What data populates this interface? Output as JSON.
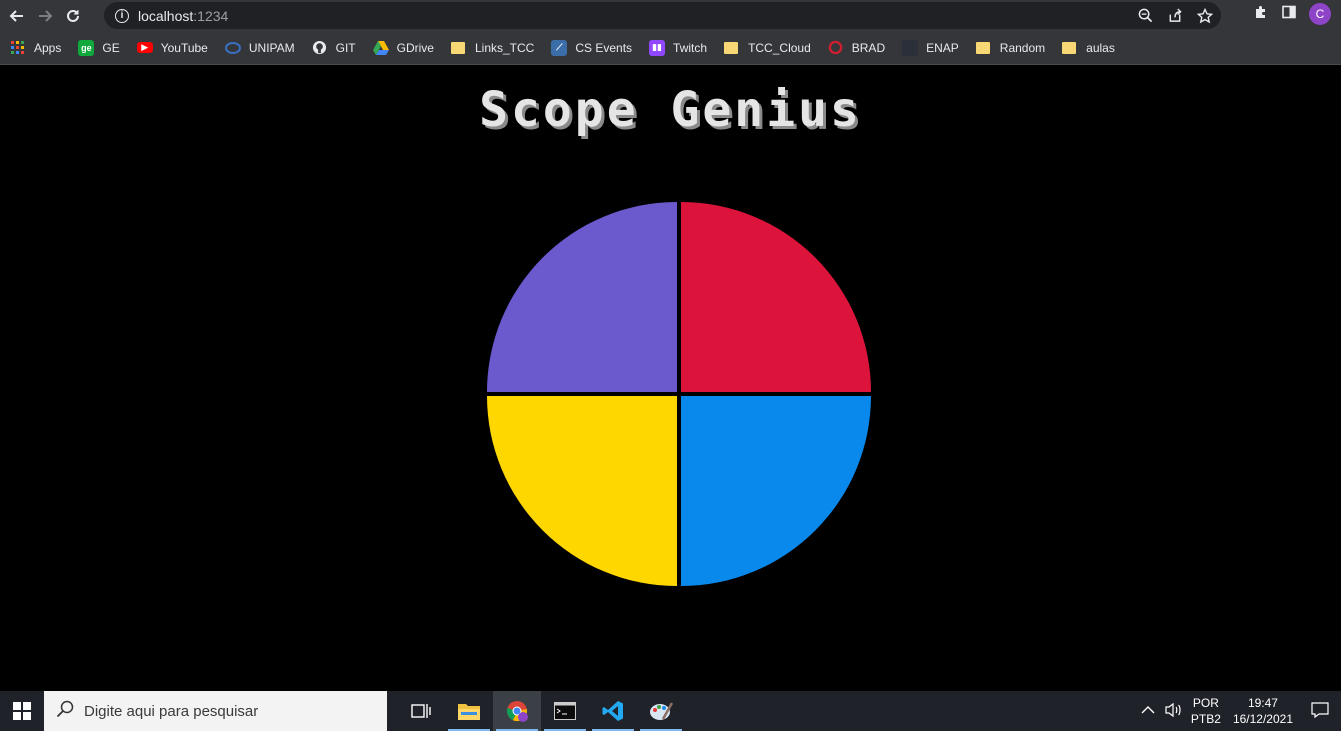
{
  "browser": {
    "url_host": "localhost",
    "url_port": ":1234",
    "avatar_letter": "C"
  },
  "bookmarks": [
    {
      "label": "Apps",
      "icon": "apps-grid-icon",
      "color": "#e8eaed"
    },
    {
      "label": "GE",
      "icon": "ge-icon",
      "color": "#0fa83c"
    },
    {
      "label": "YouTube",
      "icon": "youtube-icon",
      "color": "#ff0000"
    },
    {
      "label": "UNIPAM",
      "icon": "unipam-icon",
      "color": "#1f5fb0"
    },
    {
      "label": "GIT",
      "icon": "github-icon",
      "color": "#222222"
    },
    {
      "label": "GDrive",
      "icon": "gdrive-icon",
      "color": "#1fa463"
    },
    {
      "label": "Links_TCC",
      "icon": "folder-icon",
      "color": "#f8d775"
    },
    {
      "label": "CS Events",
      "icon": "cs-events-icon",
      "color": "#3b6ea8"
    },
    {
      "label": "Twitch",
      "icon": "twitch-icon",
      "color": "#9146ff"
    },
    {
      "label": "TCC_Cloud",
      "icon": "folder-icon",
      "color": "#f8d775"
    },
    {
      "label": "BRAD",
      "icon": "brad-icon",
      "color": "#cc1f2f"
    },
    {
      "label": "ENAP",
      "icon": "enap-icon",
      "color": "#2a2f3a"
    },
    {
      "label": "Random",
      "icon": "folder-icon",
      "color": "#f8d775"
    },
    {
      "label": "aulas",
      "icon": "folder-icon",
      "color": "#f8d775"
    }
  ],
  "page": {
    "title": "Scope Genius",
    "quadrants": [
      {
        "id": "top-right",
        "color": "#dc143c"
      },
      {
        "id": "bottom-right",
        "color": "#0a89ed"
      },
      {
        "id": "bottom-left",
        "color": "#ffd700"
      },
      {
        "id": "top-left",
        "color": "#6a5acd"
      }
    ]
  },
  "taskbar": {
    "search_placeholder": "Digite aqui para pesquisar",
    "lang_top": "POR",
    "lang_bottom": "PTB2",
    "time": "19:47",
    "date": "16/12/2021"
  }
}
